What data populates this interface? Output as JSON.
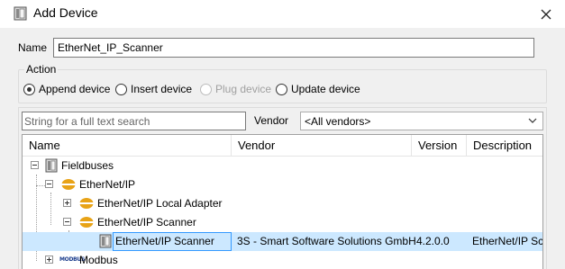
{
  "window": {
    "title": "Add Device"
  },
  "name": {
    "label": "Name",
    "value": "EtherNet_IP_Scanner"
  },
  "action": {
    "legend": "Action",
    "options": [
      {
        "label": "Append device",
        "checked": true,
        "disabled": false
      },
      {
        "label": "Insert device",
        "checked": false,
        "disabled": false
      },
      {
        "label": "Plug device",
        "checked": false,
        "disabled": true
      },
      {
        "label": "Update device",
        "checked": false,
        "disabled": false
      }
    ]
  },
  "search": {
    "placeholder": "String for a full text search"
  },
  "vendor": {
    "label": "Vendor",
    "selected": "<All vendors>"
  },
  "grid": {
    "columns": [
      "Name",
      "Vendor",
      "Version",
      "Description"
    ],
    "rows": [
      {
        "name": "Fieldbuses",
        "vendor": "",
        "version": "",
        "description": "",
        "icon": "fieldbus-icon"
      },
      {
        "name": "EtherNet/IP",
        "vendor": "",
        "version": "",
        "description": "",
        "icon": "ethernet-ip-icon"
      },
      {
        "name": "EtherNet/IP Local Adapter",
        "vendor": "",
        "version": "",
        "description": "",
        "icon": "ethernet-ip-icon"
      },
      {
        "name": "EtherNet/IP Scanner",
        "vendor": "",
        "version": "",
        "description": "",
        "icon": "ethernet-ip-icon"
      },
      {
        "name": "EtherNet/IP Scanner",
        "vendor": "3S - Smart Software Solutions GmbH",
        "version": "4.2.0.0",
        "description": "EtherNet/IP Scanner",
        "icon": "device-icon"
      },
      {
        "name": "Modbus",
        "vendor": "",
        "version": "",
        "description": "",
        "icon": "modbus-icon",
        "icon_text": "MODBUS"
      }
    ]
  },
  "colors": {
    "selection": "#cce8ff",
    "selection_border": "#3399ff",
    "panel": "#f0f0f0",
    "ethernet_icon": "#e8a317"
  }
}
